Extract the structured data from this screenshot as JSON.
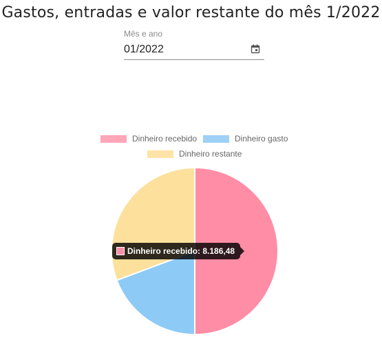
{
  "page": {
    "title": "Gastos, entradas e valor restante do mês 1/2022"
  },
  "month_field": {
    "label": "Mês e ano",
    "value": "01/2022",
    "icon": "calendar-icon"
  },
  "chart_data": {
    "type": "pie",
    "labels": [
      "Dinheiro recebido",
      "Dinheiro gasto",
      "Dinheiro restante"
    ],
    "values": [
      8186.48,
      3163.0,
      5023.48
    ],
    "colors": [
      "#ff8da6",
      "#8ecaf6",
      "#fde09c"
    ],
    "legend_position": "top",
    "start_angle_deg": -90
  },
  "tooltip": {
    "text": "Dinheiro recebido: 8.186,48",
    "color": "#ff8da6"
  }
}
